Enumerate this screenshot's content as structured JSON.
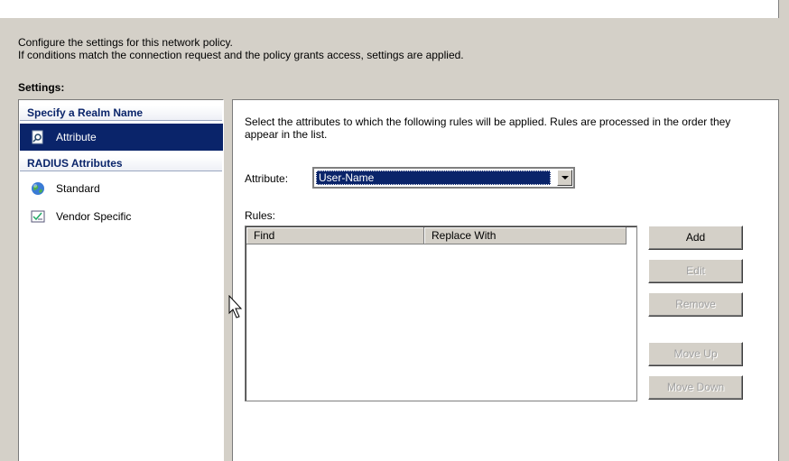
{
  "intro": {
    "line1": "Configure the settings for this network policy.",
    "line2": "If conditions match the connection request and the policy grants access, settings are applied."
  },
  "settings_label": "Settings:",
  "nav": {
    "group1_header": "Specify a Realm Name",
    "attribute_item": "Attribute",
    "group2_header": "RADIUS Attributes",
    "standard_item": "Standard",
    "vendor_item": "Vendor Specific"
  },
  "main": {
    "description": "Select the attributes to which the following rules will be applied. Rules are processed in the order they appear in the list.",
    "attribute_label": "Attribute:",
    "attribute_value": "User-Name",
    "rules_label": "Rules:",
    "columns": [
      "Find",
      "Replace With"
    ]
  },
  "buttons": {
    "add": "Add",
    "edit": "Edit",
    "remove": "Remove",
    "move_up": "Move Up",
    "move_down": "Move Down"
  },
  "colors": {
    "selection": "#0a246a",
    "dialog_bg": "#d4d0c8"
  }
}
